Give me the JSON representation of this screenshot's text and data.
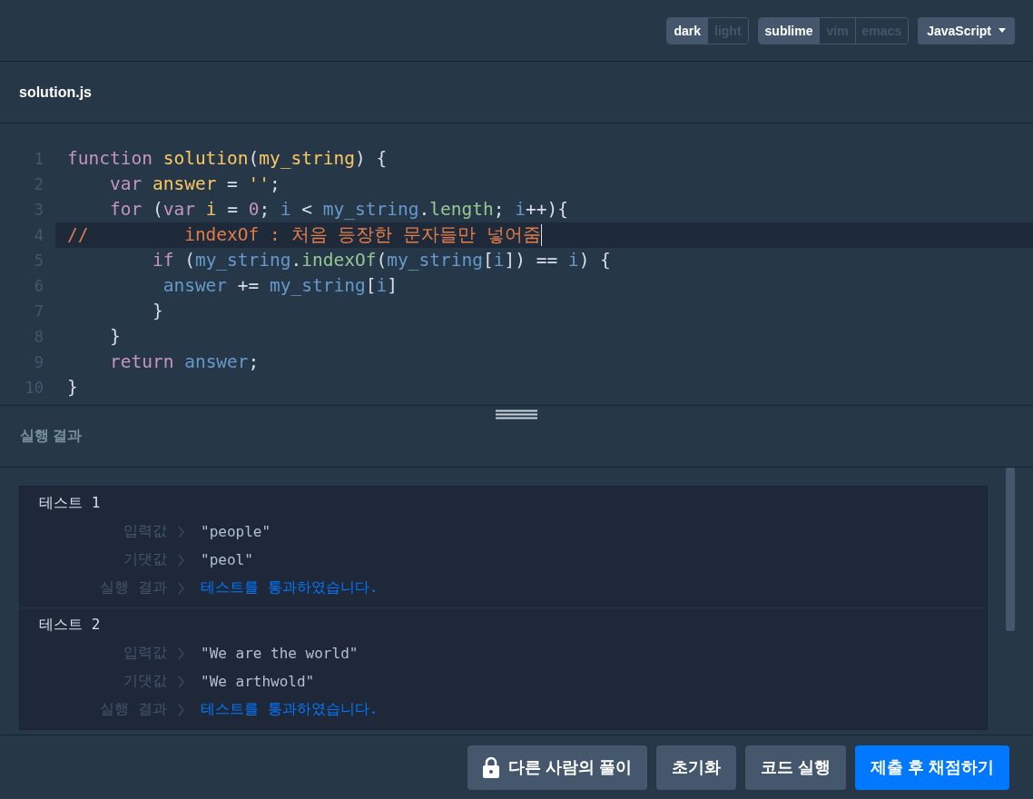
{
  "toolbar": {
    "theme": [
      {
        "label": "dark",
        "selected": true
      },
      {
        "label": "light",
        "selected": false
      }
    ],
    "keymap": [
      {
        "label": "sublime",
        "selected": true
      },
      {
        "label": "vim",
        "selected": false
      },
      {
        "label": "emacs",
        "selected": false
      }
    ],
    "language": "JavaScript"
  },
  "editor": {
    "filename": "solution.js",
    "lines": [
      {
        "number": "1",
        "active": false,
        "tokens": [
          {
            "kind": "kw",
            "text": "function"
          },
          {
            "kind": "fn",
            "text": " solution"
          },
          {
            "kind": "p",
            "text": "("
          },
          {
            "kind": "fn",
            "text": "my_string"
          },
          {
            "kind": "p",
            "text": ") {"
          }
        ]
      },
      {
        "number": "2",
        "active": false,
        "tokens": [
          {
            "kind": "kw",
            "text": "    var"
          },
          {
            "kind": "fn",
            "text": " answer"
          },
          {
            "kind": "p",
            "text": " = "
          },
          {
            "kind": "str",
            "text": "''"
          },
          {
            "kind": "p",
            "text": ";"
          }
        ]
      },
      {
        "number": "3",
        "active": false,
        "tokens": [
          {
            "kind": "kw",
            "text": "    for"
          },
          {
            "kind": "p",
            "text": " ("
          },
          {
            "kind": "kw",
            "text": "var"
          },
          {
            "kind": "fn",
            "text": " i"
          },
          {
            "kind": "p",
            "text": " = "
          },
          {
            "kind": "num",
            "text": "0"
          },
          {
            "kind": "p",
            "text": "; "
          },
          {
            "kind": "var",
            "text": "i"
          },
          {
            "kind": "p",
            "text": " < "
          },
          {
            "kind": "var",
            "text": "my_string"
          },
          {
            "kind": "p",
            "text": "."
          },
          {
            "kind": "prop",
            "text": "length"
          },
          {
            "kind": "p",
            "text": "; "
          },
          {
            "kind": "var",
            "text": "i"
          },
          {
            "kind": "p",
            "text": "++){"
          }
        ]
      },
      {
        "number": "4",
        "active": true,
        "tokens": [
          {
            "kind": "cmt",
            "text": "//         indexOf : 처음 등장한 문자들만 넣어줌"
          }
        ]
      },
      {
        "number": "5",
        "active": false,
        "tokens": [
          {
            "kind": "kw",
            "text": "        if"
          },
          {
            "kind": "p",
            "text": " ("
          },
          {
            "kind": "var",
            "text": "my_string"
          },
          {
            "kind": "p",
            "text": "."
          },
          {
            "kind": "prop",
            "text": "indexOf"
          },
          {
            "kind": "p",
            "text": "("
          },
          {
            "kind": "var",
            "text": "my_string"
          },
          {
            "kind": "p",
            "text": "["
          },
          {
            "kind": "var",
            "text": "i"
          },
          {
            "kind": "p",
            "text": "]) == "
          },
          {
            "kind": "var",
            "text": "i"
          },
          {
            "kind": "p",
            "text": ") {"
          }
        ]
      },
      {
        "number": "6",
        "active": false,
        "tokens": [
          {
            "kind": "var",
            "text": "         answer"
          },
          {
            "kind": "p",
            "text": " += "
          },
          {
            "kind": "var",
            "text": "my_string"
          },
          {
            "kind": "p",
            "text": "["
          },
          {
            "kind": "var",
            "text": "i"
          },
          {
            "kind": "p",
            "text": "]"
          }
        ]
      },
      {
        "number": "7",
        "active": false,
        "tokens": [
          {
            "kind": "p",
            "text": "        }"
          }
        ]
      },
      {
        "number": "8",
        "active": false,
        "tokens": [
          {
            "kind": "p",
            "text": "    }"
          }
        ]
      },
      {
        "number": "9",
        "active": false,
        "tokens": [
          {
            "kind": "kw",
            "text": "    return"
          },
          {
            "kind": "var",
            "text": " answer"
          },
          {
            "kind": "p",
            "text": ";"
          }
        ]
      },
      {
        "number": "10",
        "active": false,
        "tokens": [
          {
            "kind": "p",
            "text": "}"
          }
        ]
      }
    ]
  },
  "results": {
    "title": "실행 결과",
    "tests": [
      {
        "title": "테스트 1",
        "rows": [
          {
            "kind": "value",
            "label": "입력값",
            "value": "\"people\""
          },
          {
            "kind": "value",
            "label": "기댓값",
            "value": "\"peol\""
          },
          {
            "kind": "pass",
            "label": "실행 결과",
            "value": "테스트를 통과하였습니다."
          }
        ]
      },
      {
        "title": "테스트 2",
        "rows": [
          {
            "kind": "value",
            "label": "입력값",
            "value": "\"We are the world\""
          },
          {
            "kind": "value",
            "label": "기댓값",
            "value": "\"We arthwold\""
          },
          {
            "kind": "pass",
            "label": "실행 결과",
            "value": "테스트를 통과하였습니다."
          }
        ]
      }
    ]
  },
  "buttons": [
    {
      "kind": "locked",
      "label": "다른 사람의 풀이"
    },
    {
      "kind": "secondary",
      "label": "초기화"
    },
    {
      "kind": "secondary",
      "label": "코드 실행"
    },
    {
      "kind": "primary",
      "label": "제출 후 채점하기"
    }
  ]
}
